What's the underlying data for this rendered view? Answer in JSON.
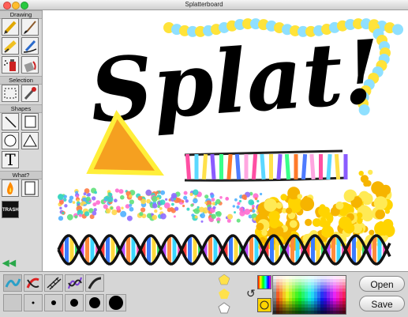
{
  "window": {
    "title": "Splatterboard"
  },
  "toolbox": {
    "sections": {
      "drawing": "Drawing",
      "selection": "Selection",
      "shapes": "Shapes",
      "what": "What?"
    },
    "text_tool_glyph": "T",
    "trash_label": "TRASH",
    "collapse_glyph": "◀◀"
  },
  "canvas": {
    "splat_text": "Splat!",
    "triangle_colors": {
      "fill": "#f5a020",
      "stroke": "#ffef3a"
    },
    "ladder_colors": [
      "#ff4fa3",
      "#5bd8ff",
      "#ffe14a",
      "#8a5cff",
      "#3aff8a",
      "#ff7a2b",
      "#4f7bff",
      "#ffa6e0"
    ],
    "dna_colors": [
      "#ff3b3b",
      "#3b7bff",
      "#ffd93b",
      "#3bdc6a",
      "#b94dff",
      "#ff8a3b",
      "#3bd6ff",
      "#ff5fbf"
    ],
    "confetti_colors": [
      "#5fe07a",
      "#4fb0ff",
      "#ff6bd0",
      "#ffd84a",
      "#8f6bff",
      "#ff7b45",
      "#34d4c4"
    ],
    "wave_colors": [
      "#ffe33a",
      "#8fe0ff"
    ],
    "splat_colors": [
      "#ffd400",
      "#ffea55",
      "#f6b400"
    ]
  },
  "actions": {
    "open_label": "Open",
    "save_label": "Save"
  },
  "palette": {
    "selected_color": "#ffd400"
  }
}
